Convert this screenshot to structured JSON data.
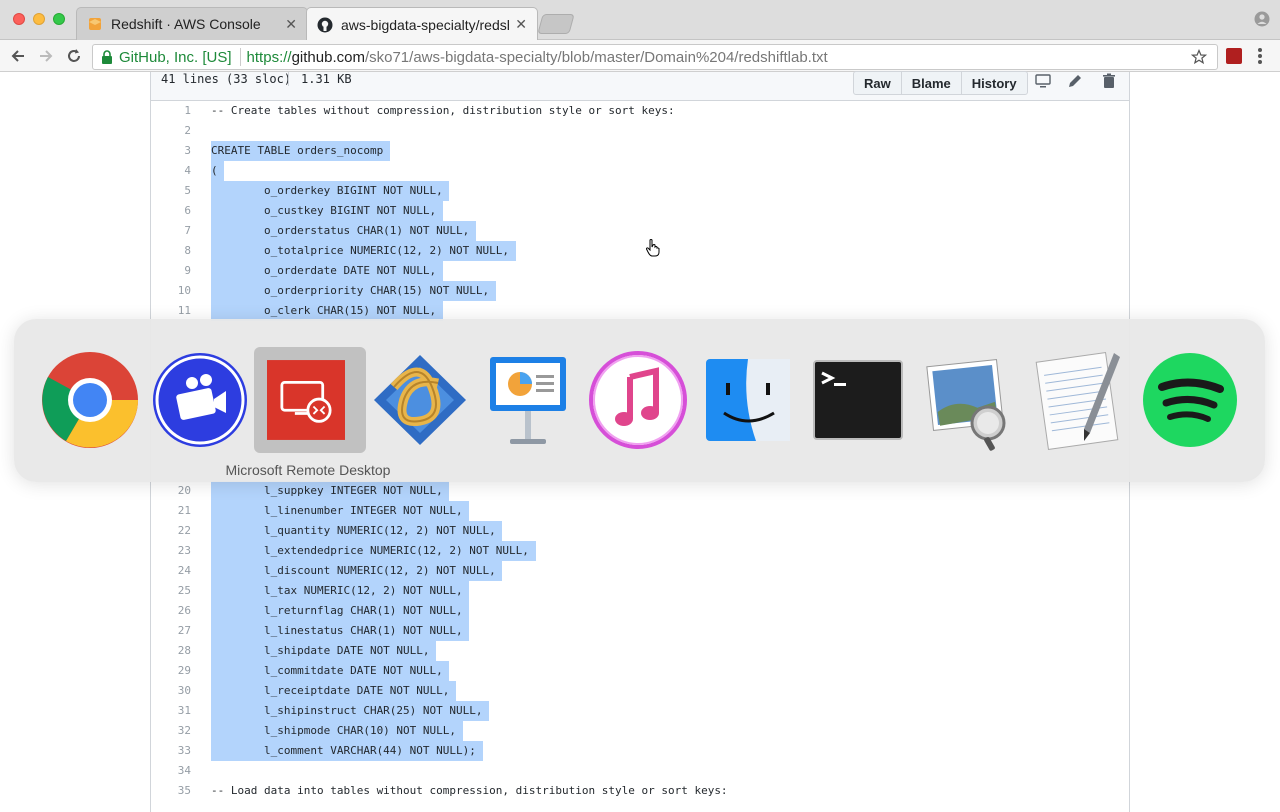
{
  "browser": {
    "tabs": [
      {
        "title": "Redshift · AWS Console",
        "icon": "aws-cube-icon",
        "active": false
      },
      {
        "title": "aws-bigdata-specialty/redshift",
        "icon": "github-icon",
        "active": true
      }
    ],
    "omnibox": {
      "secure_label": "GitHub, Inc. [US]",
      "url_scheme": "https://",
      "url_host": "github.com",
      "url_path": "/sko71/aws-bigdata-specialty/blob/master/Domain%204/redshiftlab.txt"
    }
  },
  "file": {
    "lines_info": "41 lines (33 sloc)",
    "size": "1.31 KB",
    "buttons": {
      "raw": "Raw",
      "blame": "Blame",
      "history": "History"
    },
    "lines": [
      {
        "n": "1",
        "text": "-- Create tables without compression, distribution style or sort keys:",
        "selected": false
      },
      {
        "n": "2",
        "text": "",
        "selected": false
      },
      {
        "n": "3",
        "text": "CREATE TABLE orders_nocomp ",
        "selected": true
      },
      {
        "n": "4",
        "text": "( ",
        "selected": true
      },
      {
        "n": "5",
        "text": "        o_orderkey BIGINT NOT NULL, ",
        "selected": true
      },
      {
        "n": "6",
        "text": "        o_custkey BIGINT NOT NULL, ",
        "selected": true
      },
      {
        "n": "7",
        "text": "        o_orderstatus CHAR(1) NOT NULL, ",
        "selected": true
      },
      {
        "n": "8",
        "text": "        o_totalprice NUMERIC(12, 2) NOT NULL, ",
        "selected": true
      },
      {
        "n": "9",
        "text": "        o_orderdate DATE NOT NULL, ",
        "selected": true
      },
      {
        "n": "10",
        "text": "        o_orderpriority CHAR(15) NOT NULL, ",
        "selected": true
      },
      {
        "n": "11",
        "text": "        o_clerk CHAR(15) NOT NULL, ",
        "selected": true
      },
      {
        "n": "20",
        "text": "        l_suppkey INTEGER NOT NULL, ",
        "selected": true
      },
      {
        "n": "21",
        "text": "        l_linenumber INTEGER NOT NULL, ",
        "selected": true
      },
      {
        "n": "22",
        "text": "        l_quantity NUMERIC(12, 2) NOT NULL, ",
        "selected": true
      },
      {
        "n": "23",
        "text": "        l_extendedprice NUMERIC(12, 2) NOT NULL, ",
        "selected": true
      },
      {
        "n": "24",
        "text": "        l_discount NUMERIC(12, 2) NOT NULL, ",
        "selected": true
      },
      {
        "n": "25",
        "text": "        l_tax NUMERIC(12, 2) NOT NULL, ",
        "selected": true
      },
      {
        "n": "26",
        "text": "        l_returnflag CHAR(1) NOT NULL, ",
        "selected": true
      },
      {
        "n": "27",
        "text": "        l_linestatus CHAR(1) NOT NULL, ",
        "selected": true
      },
      {
        "n": "28",
        "text": "        l_shipdate DATE NOT NULL, ",
        "selected": true
      },
      {
        "n": "29",
        "text": "        l_commitdate DATE NOT NULL, ",
        "selected": true
      },
      {
        "n": "30",
        "text": "        l_receiptdate DATE NOT NULL, ",
        "selected": true
      },
      {
        "n": "31",
        "text": "        l_shipinstruct CHAR(25) NOT NULL, ",
        "selected": true
      },
      {
        "n": "32",
        "text": "        l_shipmode CHAR(10) NOT NULL, ",
        "selected": true
      },
      {
        "n": "33",
        "text": "        l_comment VARCHAR(44) NOT NULL); ",
        "selected": true
      },
      {
        "n": "34",
        "text": "",
        "selected": false
      },
      {
        "n": "35",
        "text": "-- Load data into tables without compression, distribution style or sort keys:",
        "selected": false
      }
    ]
  },
  "switcher": {
    "selected_label": "Microsoft Remote Desktop",
    "apps": [
      {
        "icon": "chrome-icon"
      },
      {
        "icon": "screen-recorder-icon"
      },
      {
        "icon": "remote-desktop-icon",
        "selected": true
      },
      {
        "icon": "rope-app-icon"
      },
      {
        "icon": "keynote-icon"
      },
      {
        "icon": "itunes-icon"
      },
      {
        "icon": "finder-icon"
      },
      {
        "icon": "terminal-icon"
      },
      {
        "icon": "preview-icon"
      },
      {
        "icon": "textedit-icon"
      },
      {
        "icon": "spotify-icon"
      }
    ]
  },
  "colors": {
    "selection": "#b3d4fc",
    "secure_green": "#1e8a3a"
  }
}
